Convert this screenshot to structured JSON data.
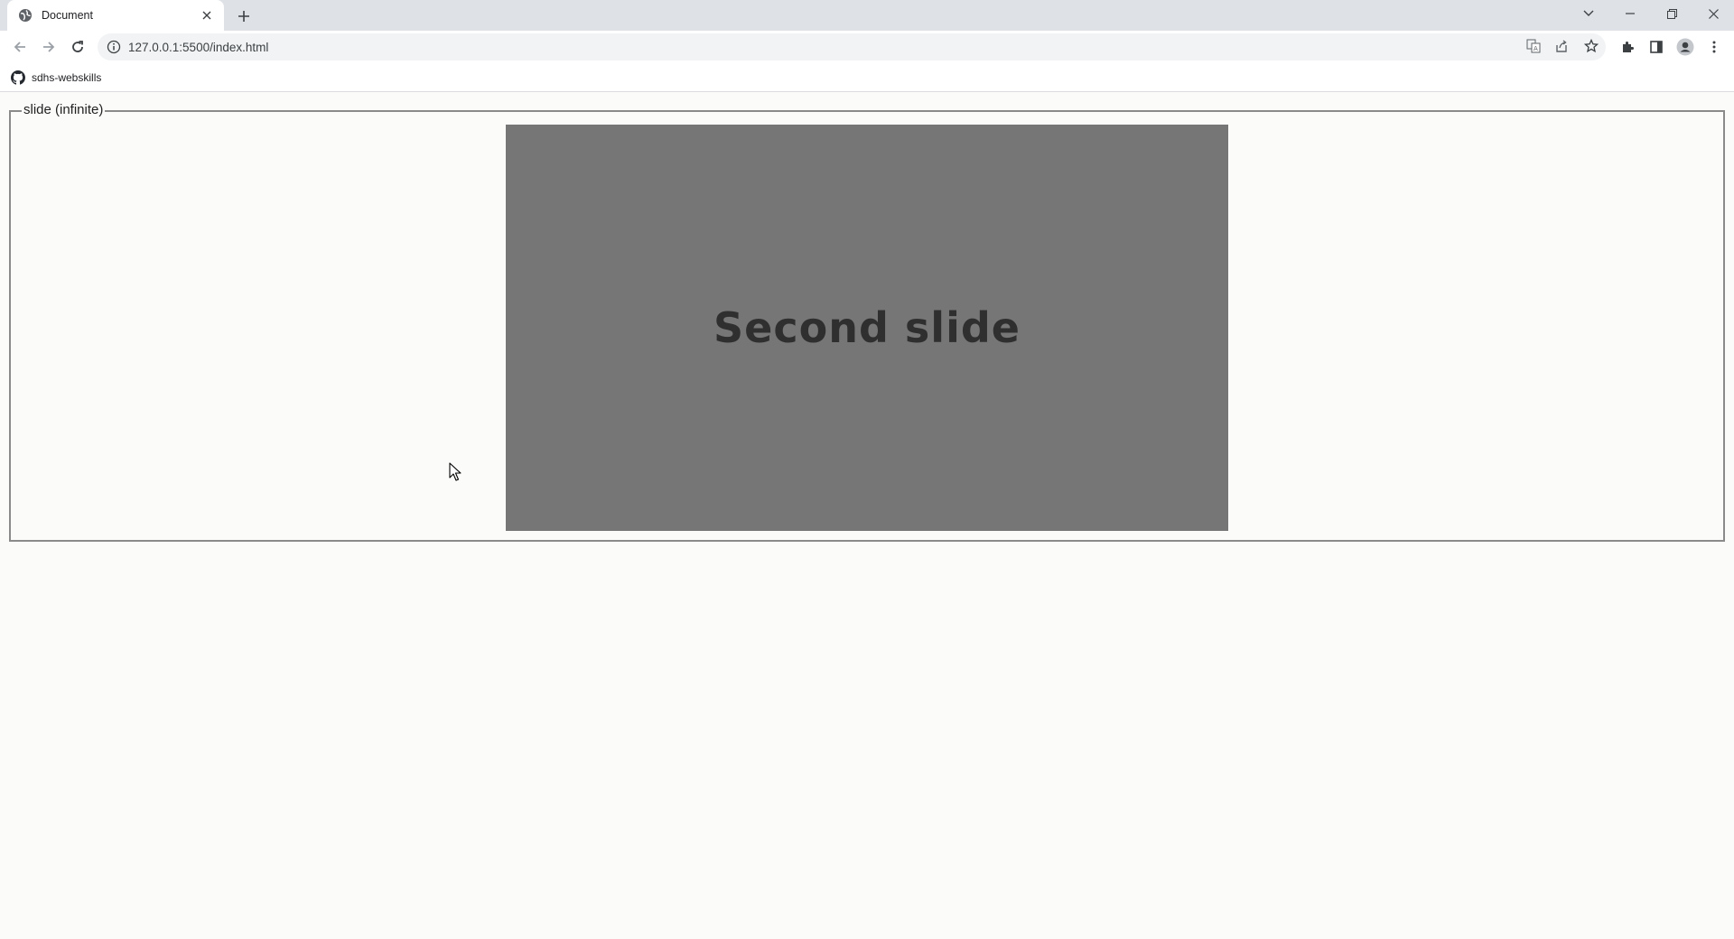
{
  "browser": {
    "tab": {
      "title": "Document"
    },
    "address": {
      "url": "127.0.0.1:5500/index.html"
    },
    "bookmarks": [
      {
        "label": "sdhs-webskills"
      }
    ]
  },
  "page": {
    "fieldset": {
      "legend": "slide (infinite)",
      "slide": {
        "label": "Second slide",
        "background": "#767676",
        "text_color": "#2f2f2f"
      }
    }
  },
  "icons": [
    "globe-icon",
    "close-icon",
    "plus-icon",
    "chevron-down-icon",
    "minimize-icon",
    "restore-icon",
    "window-close-icon",
    "back-icon",
    "forward-icon",
    "reload-icon",
    "info-icon",
    "translate-icon",
    "share-icon",
    "star-icon",
    "extensions-icon",
    "side-panel-icon",
    "profile-icon",
    "menu-icon",
    "github-icon",
    "mouse-cursor-icon"
  ]
}
